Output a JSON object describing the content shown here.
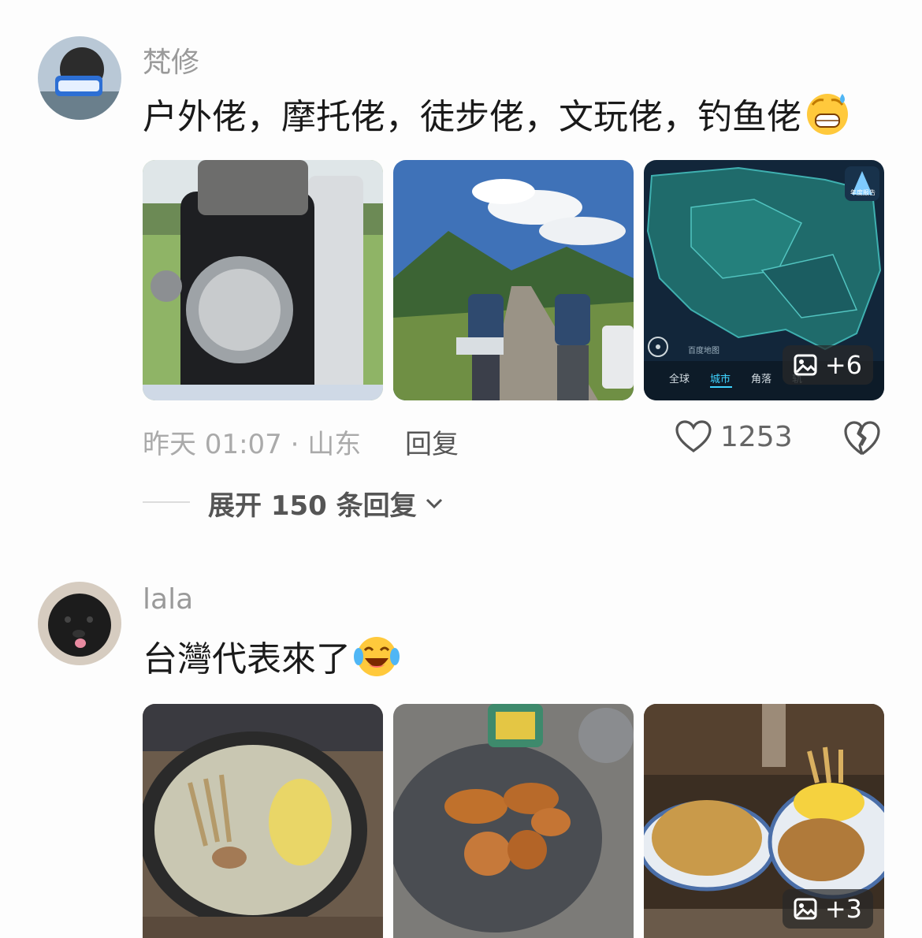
{
  "comments": [
    {
      "username": "梵修",
      "text": "户外佬，摩托佬，徒步佬，文玩佬，钓鱼佬",
      "emoji_icon": "grinning-sweat-emoji",
      "more_photos_label": "+6",
      "time_location": "昨天 01:07 · 山东",
      "reply_label": "回复",
      "like_count": "1253",
      "expand_label": "展开 150 条回复",
      "map_image": {
        "brand": "百度地图",
        "badge": "年度报告",
        "tabs": [
          "全球",
          "城市",
          "角落",
          "轨"
        ],
        "active_tab": "城市"
      }
    },
    {
      "username": "lala",
      "text": "台灣代表來了",
      "emoji_icon": "tears-of-joy-emoji",
      "more_photos_label": "+3"
    }
  ],
  "colors": {
    "accent_tab": "#3fd3ff",
    "map_bg": "#12263a",
    "text_primary": "#1a1a1a",
    "text_secondary": "#9a9a9a"
  }
}
